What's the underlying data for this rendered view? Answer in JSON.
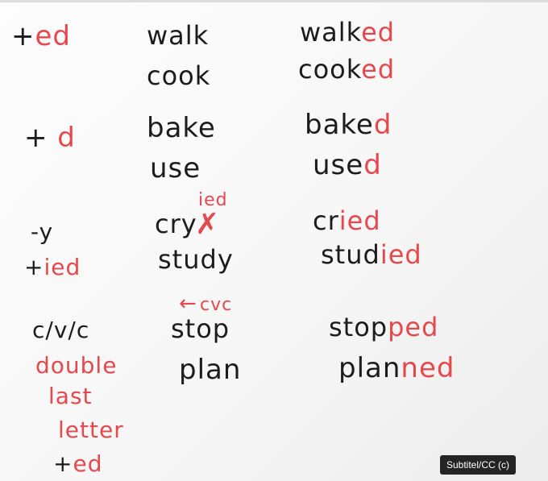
{
  "rules": [
    {
      "rule": "+ed",
      "verbs": [
        "walk",
        "cook"
      ],
      "past": [
        [
          "walk",
          "ed"
        ],
        [
          "cook",
          "ed"
        ]
      ]
    },
    {
      "rule": "+d",
      "verbs": [
        "bake",
        "use"
      ],
      "past": [
        [
          "bake",
          "d"
        ],
        [
          "use",
          "d"
        ]
      ]
    },
    {
      "rule_top": "-y",
      "rule_bottom": "+ied",
      "annotation": "ied",
      "verbs": [
        "cry",
        "study"
      ],
      "past": [
        [
          "cr",
          "ied"
        ],
        [
          "stud",
          "ied"
        ]
      ]
    },
    {
      "rule_lines": [
        "c/v/c",
        "double",
        "last",
        "letter",
        "+ed"
      ],
      "annotation": "cvc",
      "verbs": [
        "stop",
        "plan"
      ],
      "past": [
        [
          "stop",
          "ped"
        ],
        [
          "plan",
          "ned"
        ]
      ]
    }
  ],
  "caption": "Subtitel/CC (c)"
}
